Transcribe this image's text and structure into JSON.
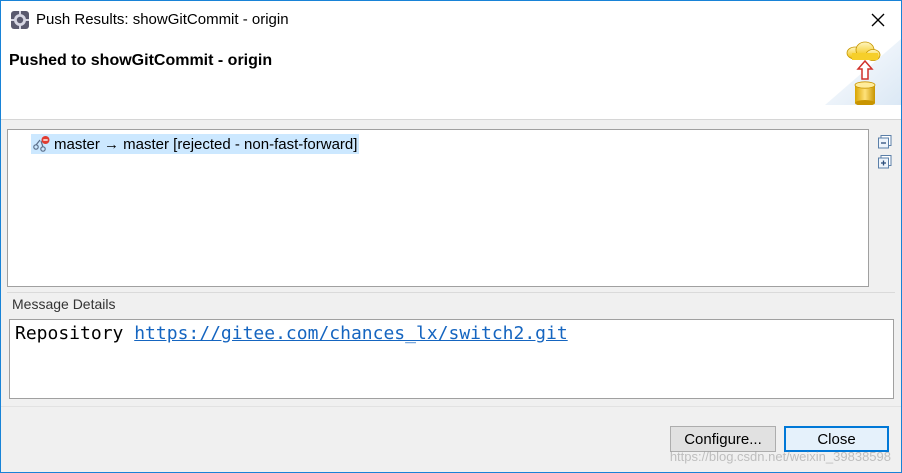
{
  "window": {
    "title": "Push Results: showGitCommit - origin",
    "close_glyph": "✕"
  },
  "header": {
    "title": "Pushed to showGitCommit - origin",
    "graphic_icon": "push-to-repository-icon"
  },
  "tree": {
    "rows": [
      {
        "icon": "ref-update-rejected-icon",
        "label": "master → master [rejected - non-fast-forward]",
        "selected": true
      }
    ],
    "collapse_all_icon": "collapse-all-icon",
    "expand_all_icon": "expand-all-icon"
  },
  "message_details": {
    "label": "Message Details",
    "prefix": "Repository ",
    "link": "https://gitee.com/chances_lx/switch2.git"
  },
  "buttons": {
    "configure": "Configure...",
    "close": "Close"
  },
  "watermark": "https://blog.csdn.net/weixin_39838598",
  "colors": {
    "accent": "#0078d7",
    "selection": "#cce8ff",
    "link": "#1565c0"
  }
}
